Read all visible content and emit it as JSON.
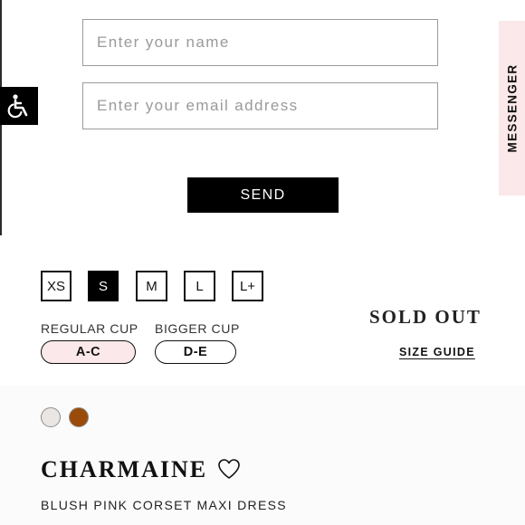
{
  "form": {
    "name_placeholder": "Enter your name",
    "email_placeholder": "Enter your email address",
    "send_label": "SEND"
  },
  "messenger": {
    "label": "MESSENGER",
    "background": "#fbe8ea"
  },
  "accessibility": {
    "icon": "accessibility-icon"
  },
  "sizes": [
    {
      "label": "XS",
      "selected": false
    },
    {
      "label": "S",
      "selected": true
    },
    {
      "label": "M",
      "selected": false
    },
    {
      "label": "L",
      "selected": false
    },
    {
      "label": "L+",
      "selected": false
    }
  ],
  "cups": [
    {
      "heading": "REGULAR CUP",
      "option": "A-C",
      "selected": true,
      "color": "#fbe8ea"
    },
    {
      "heading": "BIGGER CUP",
      "option": "D-E",
      "selected": false,
      "color": "#ffffff"
    }
  ],
  "stock_status": "SOLD OUT",
  "size_guide_label": "SIZE GUIDE",
  "swatches": [
    {
      "name": "light-grey",
      "color": "#e9e6e3"
    },
    {
      "name": "brown",
      "color": "#9a4b0a"
    }
  ],
  "product": {
    "name": "CHARMAINE",
    "description": "BLUSH PINK CORSET MAXI DRESS",
    "favorite_icon": "heart-icon"
  }
}
